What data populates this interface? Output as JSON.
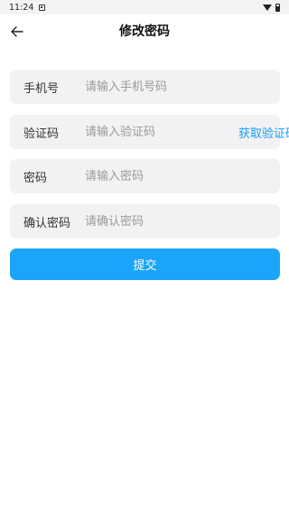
{
  "status_bar": {
    "time": "11:24"
  },
  "nav": {
    "title": "修改密码",
    "back_icon": "arrow-left-icon"
  },
  "form": {
    "phone": {
      "label": "手机号",
      "placeholder": "请输入手机号码",
      "value": ""
    },
    "code": {
      "label": "验证码",
      "placeholder": "请输入验证码",
      "value": "",
      "action": "获取验证码"
    },
    "password": {
      "label": "密码",
      "placeholder": "请输入密码",
      "value": ""
    },
    "confirm": {
      "label": "确认密码",
      "placeholder": "请确认密码",
      "value": ""
    },
    "submit_label": "提交"
  },
  "colors": {
    "accent": "#1aa5fb",
    "link": "#1a9cf5",
    "field_bg": "#f2f2f4"
  }
}
